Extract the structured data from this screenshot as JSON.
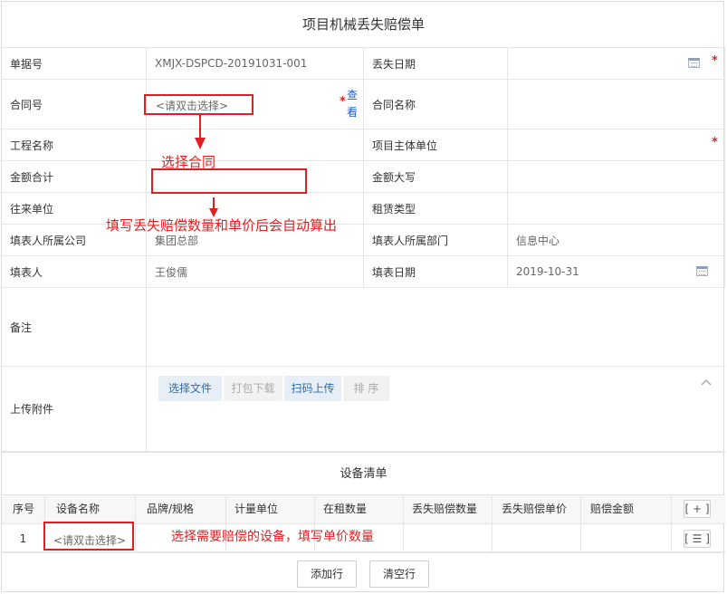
{
  "form": {
    "title": "项目机械丢失赔偿单",
    "labels": {
      "doc_no": "单据号",
      "loss_date": "丢失日期",
      "contract_no": "合同号",
      "contract_name": "合同名称",
      "project_name": "工程名称",
      "project_entity": "项目主体单位",
      "amount_total": "金额合计",
      "amount_upper": "金额大写",
      "partner": "往来单位",
      "lease_type": "租赁类型",
      "filler_company": "填表人所属公司",
      "filler_dept": "填表人所属部门",
      "filler": "填表人",
      "fill_date": "填表日期",
      "remark": "备注",
      "attachments": "上传附件"
    },
    "values": {
      "doc_no": "XMJX-DSPCD-20191031-001",
      "filler_company": "集团总部",
      "filler_dept": "信息中心",
      "filler": "王俊儒",
      "fill_date": "2019-10-31"
    },
    "contract_placeholder": "<请双击选择>",
    "view_link": "查看",
    "required_mark": "*"
  },
  "annotations": {
    "select_contract": "选择合同",
    "fill_qty_price": "填写丢失赔偿数量和单价后会自动算出",
    "select_equipment": "选择需要赔偿的设备，填写单价数量",
    "highlight_color": "#e02020"
  },
  "attachment_toolbar": {
    "select_file": "选择文件",
    "pack_download": "打包下载",
    "scan_upload": "扫码上传",
    "sort": "排 序"
  },
  "equipment": {
    "title": "设备清单",
    "columns": [
      "序号",
      "设备名称",
      "品牌/规格",
      "计量单位",
      "在租数量",
      "丢失赔偿数量",
      "丢失赔偿单价",
      "赔偿金额"
    ],
    "add_col_btn": "[ + ]",
    "row_menu_btn": "[ ☰ ]",
    "rows": [
      {
        "index": "1",
        "name_placeholder": "<请双击选择>"
      }
    ],
    "add_row": "添加行",
    "clear_row": "清空行"
  }
}
